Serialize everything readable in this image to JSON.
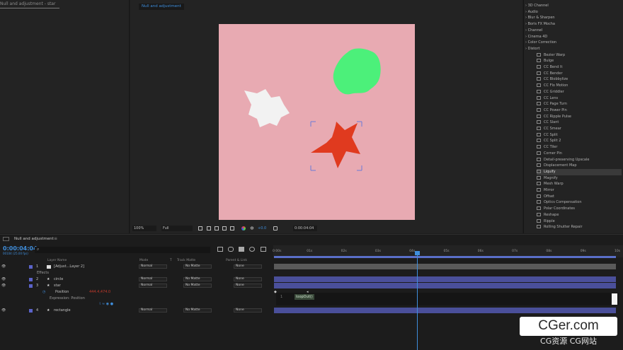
{
  "project_panel": {
    "tab_label": "Null and adjustment - star"
  },
  "viewer": {
    "tab_label": "Null and adjustment",
    "toolbar": {
      "zoom": "100%",
      "resolution": "Full",
      "exposure": "+0.0",
      "timecode": "0:00:04:04"
    }
  },
  "effects": {
    "categories": [
      "3D Channel",
      "Audio",
      "Blur & Sharpen",
      "Boris FX Mocha",
      "Channel",
      "Cinema 4D",
      "Color Correction",
      "Distort"
    ],
    "distort_items": [
      "Bezier Warp",
      "Bulge",
      "CC Bend It",
      "CC Bender",
      "CC Blobbylize",
      "CC Flo Motion",
      "CC Griddler",
      "CC Lens",
      "CC Page Turn",
      "CC Power Pin",
      "CC Ripple Pulse",
      "CC Slant",
      "CC Smear",
      "CC Split",
      "CC Split 2",
      "CC Tiler",
      "Corner Pin",
      "Detail-preserving Upscale",
      "Displacement Map",
      "Liquify",
      "Magnify",
      "Mesh Warp",
      "Mirror",
      "Offset",
      "Optics Compensation",
      "Polar Coordinates",
      "Reshape",
      "Ripple",
      "Rolling Shutter Repair"
    ],
    "selected": "Liquify"
  },
  "timeline": {
    "tab_label": "Null and adjustment",
    "time": "0:00:04:04",
    "fps": "00104 (25.00 fps)",
    "headers": {
      "layer_name": "Layer Name",
      "mode": "Mode",
      "t": "T",
      "track_matte": "Track Matte",
      "parent": "Parent & Link"
    },
    "layers": [
      {
        "num": "1",
        "name": "[Adjust...Layer 2]",
        "mode": "Normal",
        "matte": "No Matte",
        "parent": "None"
      },
      {
        "num": "",
        "name": "Effects",
        "mode": "",
        "matte": "",
        "parent": ""
      },
      {
        "num": "2",
        "name": "circle",
        "mode": "Normal",
        "matte": "No Matte",
        "parent": "None"
      },
      {
        "num": "3",
        "name": "star",
        "mode": "Normal",
        "matte": "No Matte",
        "parent": "None"
      },
      {
        "num": "",
        "name": "Position",
        "mode": "",
        "matte": "",
        "parent": ""
      },
      {
        "num": "",
        "name": "Expression: Position",
        "mode": "",
        "matte": "",
        "parent": ""
      },
      {
        "num": "4",
        "name": "rectangle",
        "mode": "Normal",
        "matte": "No Matte",
        "parent": "None"
      }
    ],
    "position_value": "444.4,474.0",
    "ruler": [
      "0:00s",
      "01s",
      "02s",
      "03s",
      "04s",
      "05s",
      "06s",
      "07s",
      "08s",
      "09s",
      "10s"
    ],
    "expression": {
      "line": "1",
      "code": "loopOut()"
    }
  },
  "watermark": {
    "brand": "CGer.com",
    "sub": "CG资源 CG网站"
  },
  "colors": {
    "accent": "#3f8edc",
    "canvas": "#e8aab2",
    "label_purple": "#5b63c9",
    "star": "#e03a1f",
    "blob_green": "#4cf07a"
  }
}
